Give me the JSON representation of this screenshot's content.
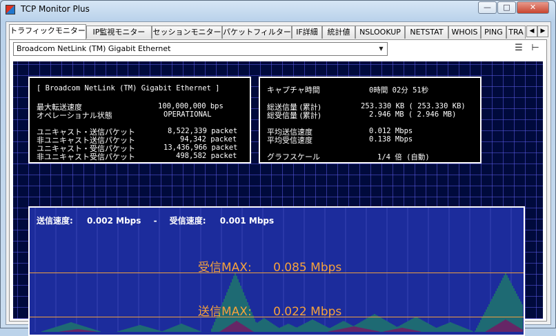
{
  "window": {
    "title": "TCP Monitor Plus"
  },
  "tabs": [
    {
      "label": "トラフィックモニター"
    },
    {
      "label": "IP監視モニター"
    },
    {
      "label": "セッションモニター"
    },
    {
      "label": "パケットフィルター"
    },
    {
      "label": "IF詳細"
    },
    {
      "label": "統計値"
    },
    {
      "label": "NSLOOKUP"
    },
    {
      "label": "NETSTAT"
    },
    {
      "label": "WHOIS"
    },
    {
      "label": "PING"
    },
    {
      "label": "TRA"
    }
  ],
  "adapter": {
    "selected": "Broadcom NetLink (TM) Gigabit Ethernet"
  },
  "interface_info": {
    "name": "[ Broadcom NetLink (TM) Gigabit Ethernet ]",
    "rows": [
      {
        "label": "最大転送速度",
        "value": "100,000,000 bps"
      },
      {
        "label": "オペレーショナル状態",
        "value": "OPERATIONAL"
      },
      {
        "label": "ユニキャスト・送信パケット",
        "value": "8,522,339 packet"
      },
      {
        "label": "非ユニキャスト送信パケット",
        "value": "94,342 packet"
      },
      {
        "label": "ユニキャスト・受信パケット",
        "value": "13,436,966 packet"
      },
      {
        "label": "非ユニキャスト受信パケット",
        "value": "498,582 packet"
      }
    ]
  },
  "capture_info": {
    "rows": [
      {
        "label": "キャプチャ時間",
        "value": "0時間 02分 51秒"
      },
      {
        "label": "総送信量 (累計)",
        "value": "253.330 KB ( 253.330 KB)"
      },
      {
        "label": "総受信量 (累計)",
        "value": "2.946 MB (   2.946 MB)"
      },
      {
        "label": "平均送信速度",
        "value": "0.012 Mbps"
      },
      {
        "label": "平均受信速度",
        "value": "0.138 Mbps"
      },
      {
        "label": "グラフスケール",
        "value": "1/4 倍 (自動)"
      }
    ]
  },
  "traffic": {
    "send_label": "送信速度:",
    "send_value": "0.002 Mbps",
    "separator": "-",
    "recv_label": "受信速度:",
    "recv_value": "0.001 Mbps",
    "recv_max_label": "受信MAX:",
    "recv_max_value": "0.085 Mbps",
    "send_max_label": "送信MAX:",
    "send_max_value": "0.022 Mbps"
  },
  "colors": {
    "recv_graph": "#1fa84a",
    "send_graph": "#b02030",
    "max_line": "#f0a040",
    "graph_bg": "#1c2c9c"
  },
  "icons": {
    "list": "list-icon",
    "pin": "pin-icon"
  }
}
